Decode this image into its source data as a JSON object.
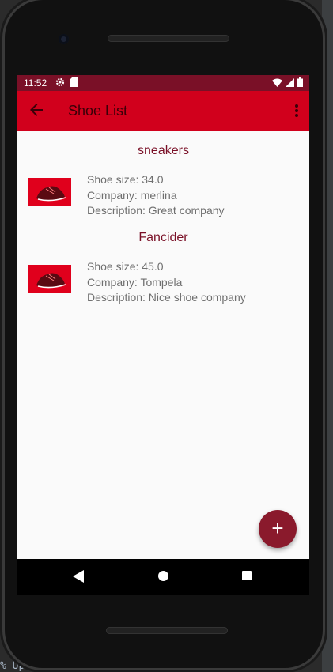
{
  "status_bar": {
    "time": "11:52",
    "left_icons": [
      "gear-icon",
      "sd-card-icon"
    ],
    "right_icons": [
      "wifi-icon",
      "signal-icon",
      "battery-icon"
    ]
  },
  "app_bar": {
    "title": "Shoe List",
    "back_icon": "arrow-left-icon",
    "menu_icon": "more-vertical-icon"
  },
  "shoes": [
    {
      "name": "sneakers",
      "size": "Shoe size: 34.0",
      "company": "Company: merlina",
      "description": "Description: Great company"
    },
    {
      "name": "Fancider",
      "size": "Shoe size: 45.0",
      "company": "Company: Tompela",
      "description": "Description: Nice shoe company"
    }
  ],
  "fab": {
    "label": "+"
  },
  "ide": {
    "bottom_text": "% Up to date"
  },
  "colors": {
    "app_bar": "#d1001c",
    "status_bar": "#7a1027",
    "accent": "#7a1027",
    "fab": "#8a1a2c",
    "background": "#fafafa"
  }
}
